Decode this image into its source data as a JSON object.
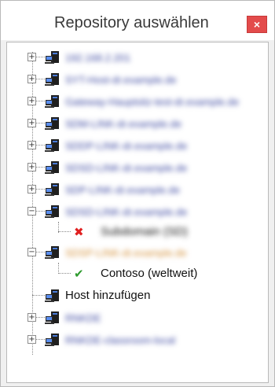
{
  "window": {
    "title": "Repository auswählen",
    "close_glyph": "×"
  },
  "tree": {
    "hosts": [
      {
        "label": "192.168.2.201",
        "expanded": false
      },
      {
        "label": "SYT-Host-dr.example.de",
        "expanded": false
      },
      {
        "label": "Gateway-Hauptsitz-test-dr.example.de",
        "expanded": false
      },
      {
        "label": "SDM-LINK-dr.example.de",
        "expanded": false
      },
      {
        "label": "SDDP-LINK-dr.example.de",
        "expanded": false
      },
      {
        "label": "SDSD-LINK-dr.example.de",
        "expanded": false
      },
      {
        "label": "SDP-LINK-dr.example.de",
        "expanded": false
      },
      {
        "label": "SDSD-LINK-dr.example.de",
        "expanded": true
      },
      {
        "label": "SDSP-LINK-dr.example.de",
        "expanded": true
      },
      {
        "label": "Host hinzufügen",
        "expanded": null
      },
      {
        "label": "RNKDE",
        "expanded": false
      },
      {
        "label": "RNKDE-classroom-local",
        "expanded": false
      }
    ],
    "children": {
      "error_child": {
        "label": "Subdomain (SD)",
        "status": "error",
        "glyph": "✖"
      },
      "ok_child": {
        "label": "Contoso (weltweit)",
        "status": "ok",
        "glyph": "✔"
      }
    },
    "expander_collapsed": "+",
    "expander_expanded": "−"
  },
  "colors": {
    "close_button": "#e34b4b",
    "error": "#e02020",
    "ok": "#2e9a2e",
    "blurred_text": "#3b47a0"
  },
  "icons": [
    "pc-icon",
    "error-x-icon",
    "check-icon",
    "close-icon"
  ]
}
